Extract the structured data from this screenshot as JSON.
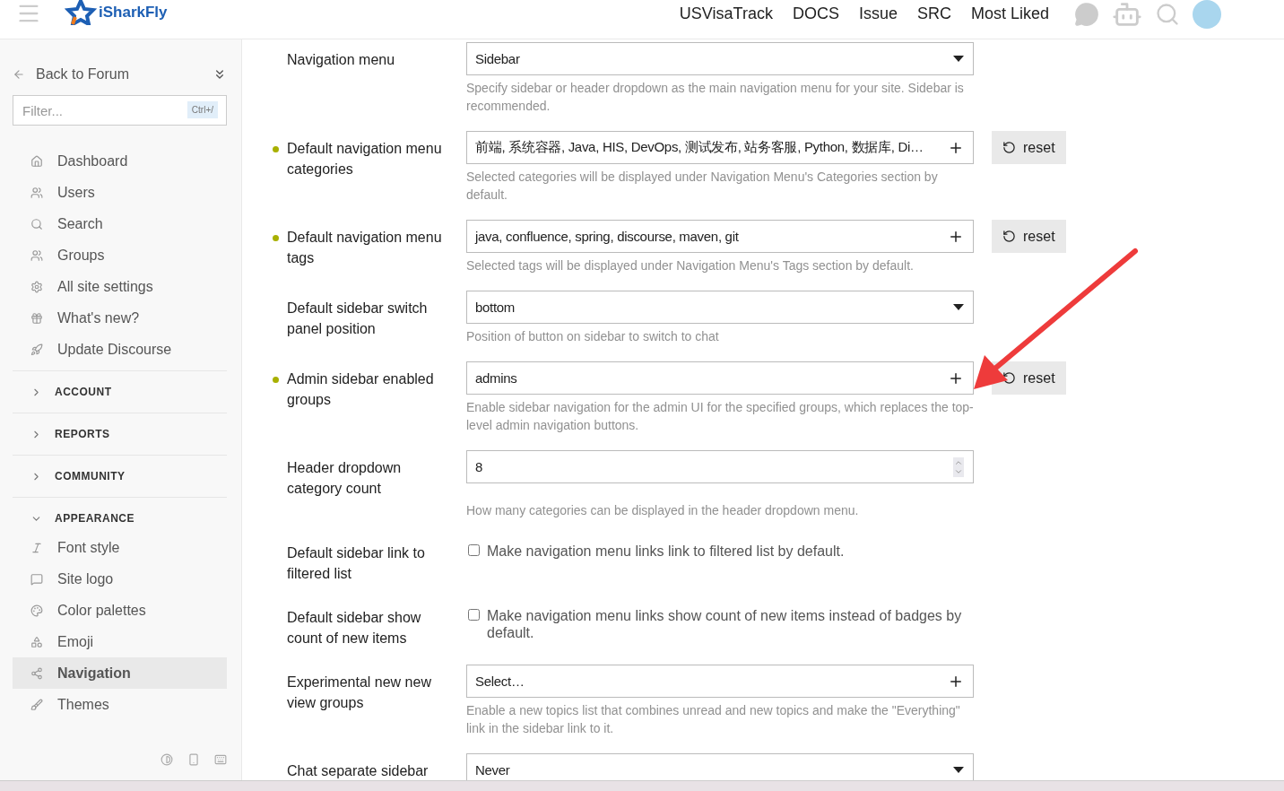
{
  "header": {
    "logo_text": "iSharkFly",
    "nav_links": [
      "USVisaTrack",
      "DOCS",
      "Issue",
      "SRC",
      "Most Liked"
    ]
  },
  "sidebar": {
    "back_label": "Back to Forum",
    "filter": {
      "placeholder": "Filter...",
      "shortcut": "Ctrl+/"
    },
    "items": [
      {
        "label": "Dashboard",
        "selected": false
      },
      {
        "label": "Users",
        "selected": false
      },
      {
        "label": "Search",
        "selected": false
      },
      {
        "label": "Groups",
        "selected": false
      },
      {
        "label": "All site settings",
        "selected": false
      },
      {
        "label": "What's new?",
        "selected": false
      },
      {
        "label": "Update Discourse",
        "selected": false
      }
    ],
    "sections": [
      {
        "title": "ACCOUNT",
        "expanded": false
      },
      {
        "title": "REPORTS",
        "expanded": false
      },
      {
        "title": "COMMUNITY",
        "expanded": false
      },
      {
        "title": "APPEARANCE",
        "expanded": true,
        "items": [
          {
            "label": "Font style",
            "selected": false
          },
          {
            "label": "Site logo",
            "selected": false
          },
          {
            "label": "Color palettes",
            "selected": false
          },
          {
            "label": "Emoji",
            "selected": false
          },
          {
            "label": "Navigation",
            "selected": true
          },
          {
            "label": "Themes",
            "selected": false
          }
        ]
      }
    ]
  },
  "settings": [
    {
      "label": "Navigation menu",
      "modified": false,
      "kind": "select",
      "value": "Sidebar",
      "description": "Specify sidebar or header dropdown as the main navigation menu for your site. Sidebar is recommended."
    },
    {
      "label": "Default navigation menu categories",
      "modified": true,
      "kind": "list",
      "value": "前端, 系统容器, Java, HIS, DevOps, 测试发布, 站务客服, Python, 数据库, Di…",
      "description": "Selected categories will be displayed under Navigation Menu's Categories section by default.",
      "reset": "reset"
    },
    {
      "label": "Default navigation menu tags",
      "modified": true,
      "kind": "list",
      "value": "java, confluence, spring, discourse, maven, git",
      "description": "Selected tags will be displayed under Navigation Menu's Tags section by default.",
      "reset": "reset"
    },
    {
      "label": "Default sidebar switch panel position",
      "modified": false,
      "kind": "select",
      "value": "bottom",
      "description": "Position of button on sidebar to switch to chat"
    },
    {
      "label": "Admin sidebar enabled groups",
      "modified": true,
      "kind": "list",
      "value": "admins",
      "description": "Enable sidebar navigation for the admin UI for the specified groups, which replaces the top-level admin navigation buttons.",
      "reset": "reset"
    },
    {
      "label": "Header dropdown category count",
      "modified": false,
      "kind": "number",
      "value": "8",
      "description": "How many categories can be displayed in the header dropdown menu."
    },
    {
      "label": "Default sidebar link to filtered list",
      "modified": false,
      "kind": "checkbox",
      "checked": false,
      "value": "Make navigation menu links link to filtered list by default."
    },
    {
      "label": "Default sidebar show count of new items",
      "modified": false,
      "kind": "checkbox",
      "checked": false,
      "value": "Make navigation menu links show count of new items instead of badges by default."
    },
    {
      "label": "Experimental new new view groups",
      "modified": false,
      "kind": "list",
      "value": "Select…",
      "description": "Enable a new topics list that combines unread and new topics and make the \"Everything\" link in the sidebar link to it."
    },
    {
      "label": "Chat separate sidebar",
      "modified": false,
      "kind": "select",
      "value": "Never"
    }
  ]
}
